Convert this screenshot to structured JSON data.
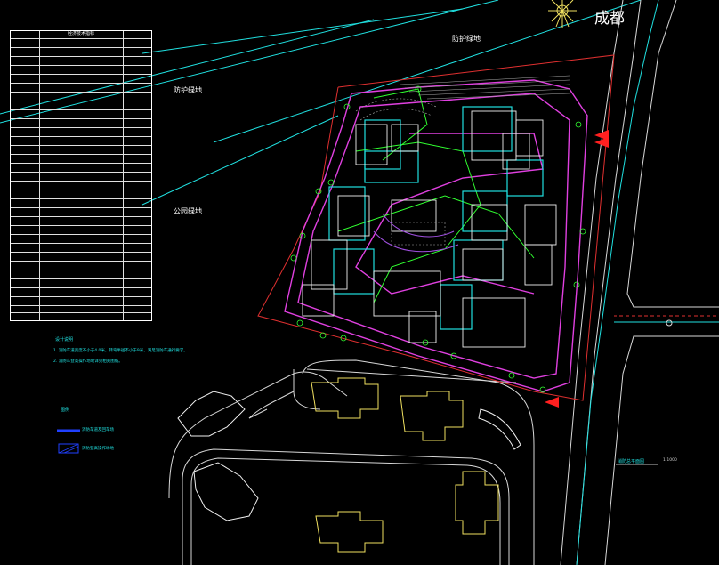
{
  "city_title": "成都",
  "area_labels": {
    "protect_green_top": "防护绿地",
    "protect_green_left": "防护绿地",
    "park_green": "公园绿地"
  },
  "table": {
    "title": "经济技术指标"
  },
  "notes": {
    "heading": "设计说明",
    "line1": "1. 消防车道宽度不小于4.0米，转弯半径不小于9米，满足消防车通行要求。",
    "line2": "2. 消防车登高操作场地详见相关图纸。"
  },
  "legend": {
    "heading": "图例",
    "item1": "消防车道及回车场",
    "item2": "消防登高操作场地"
  },
  "drawing_title": "消防总平面图",
  "drawing_scale": "1:1000",
  "colors": {
    "background": "#000000",
    "road_cyan": "#20e0e0",
    "red_line": "#e03030",
    "site_magenta": "#e040e0",
    "fire_lane_green": "#30ff30",
    "buildings_white": "#f0f0f0",
    "buildings_yellow": "#f0e060",
    "legend_blue": "#2040ff"
  }
}
